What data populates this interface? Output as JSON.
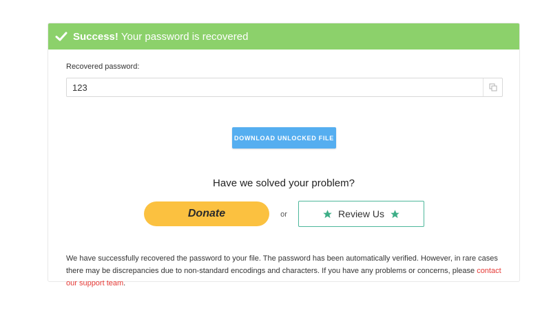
{
  "banner": {
    "strong": "Success!",
    "message": "Your password is recovered",
    "icon": "checkmark-icon",
    "color": "#8cd16b"
  },
  "password": {
    "label": "Recovered password:",
    "value": "123",
    "copy_icon": "copy-icon"
  },
  "download_button": {
    "label": "DOWNLOAD UNLOCKED FILE",
    "color": "#55aef0"
  },
  "feedback": {
    "question": "Have we solved your problem?",
    "donate_label": "Donate",
    "donate_color": "#fbc140",
    "or_text": "or",
    "review_label": "Review Us",
    "review_color": "#4cb79a",
    "star_icon": "star-icon"
  },
  "description": {
    "text": "We have successfully recovered the password to your file. The password has been automatically verified. However, in rare cases there may be discrepancies due to non-standard encodings and characters. If you have any problems or concerns, please ",
    "link_text": "contact our support team",
    "suffix": ".",
    "link_color": "#e53935"
  }
}
